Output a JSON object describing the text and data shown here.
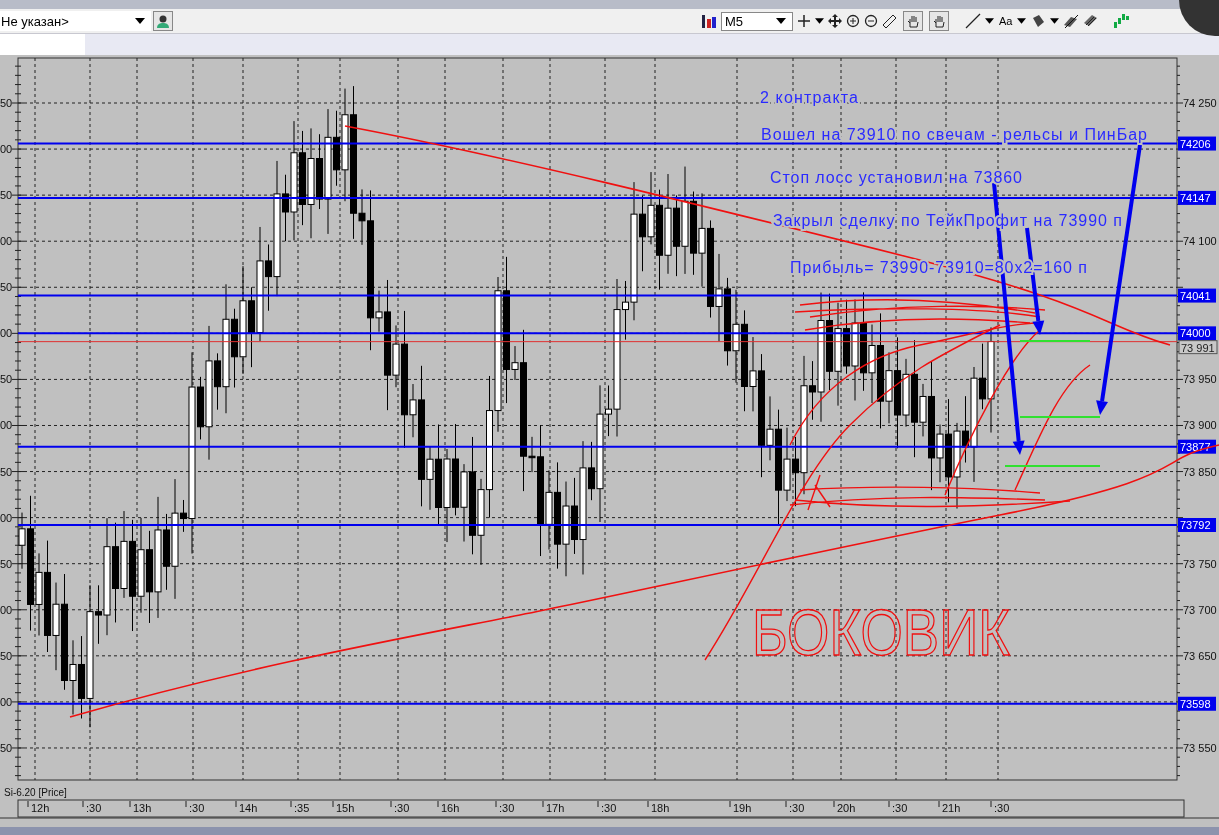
{
  "toolbar": {
    "account_select": {
      "value": "Не указан>"
    },
    "timeframe_select": {
      "value": "M5"
    },
    "text_tool": "Aa"
  },
  "chart": {
    "left_axis_labels": [
      "50",
      "00",
      "50",
      "00",
      "50",
      "00",
      "50",
      "00",
      "50",
      "00",
      "50",
      "00",
      "50",
      "00",
      "50"
    ],
    "price_ticks": [
      "74 250",
      "74 100",
      "73 950",
      "73 900",
      "73 850",
      "73 750",
      "73 700",
      "73 650",
      "73 550"
    ],
    "levels": [
      {
        "label": "74206"
      },
      {
        "label": "74147"
      },
      {
        "label": "74041"
      },
      {
        "label": "74000"
      },
      {
        "label": "73877"
      },
      {
        "label": "73792"
      },
      {
        "label": "73598"
      }
    ],
    "current_price": "73 991",
    "annotations": [
      "2 контракта",
      "Вошел на 73910 по свечам - рельсы и ПинБар",
      "Стоп лосс установил на 73860",
      "Закрыл сделку по ТейкПрофит на 73990 п",
      "Прибыль= 73990-73910=80х2=160 п"
    ],
    "handwritten_note": "БОКОВИК",
    "instrument_label": "Si-6.20 [Price]",
    "time_labels": [
      "12h",
      ":30",
      "13h",
      ":30",
      "14h",
      ":35",
      "15h",
      ":30",
      "16h",
      ":30",
      "17h",
      ":30",
      "18h",
      "19h",
      ":30",
      "20h",
      ":30",
      "21h",
      ":30"
    ]
  }
}
